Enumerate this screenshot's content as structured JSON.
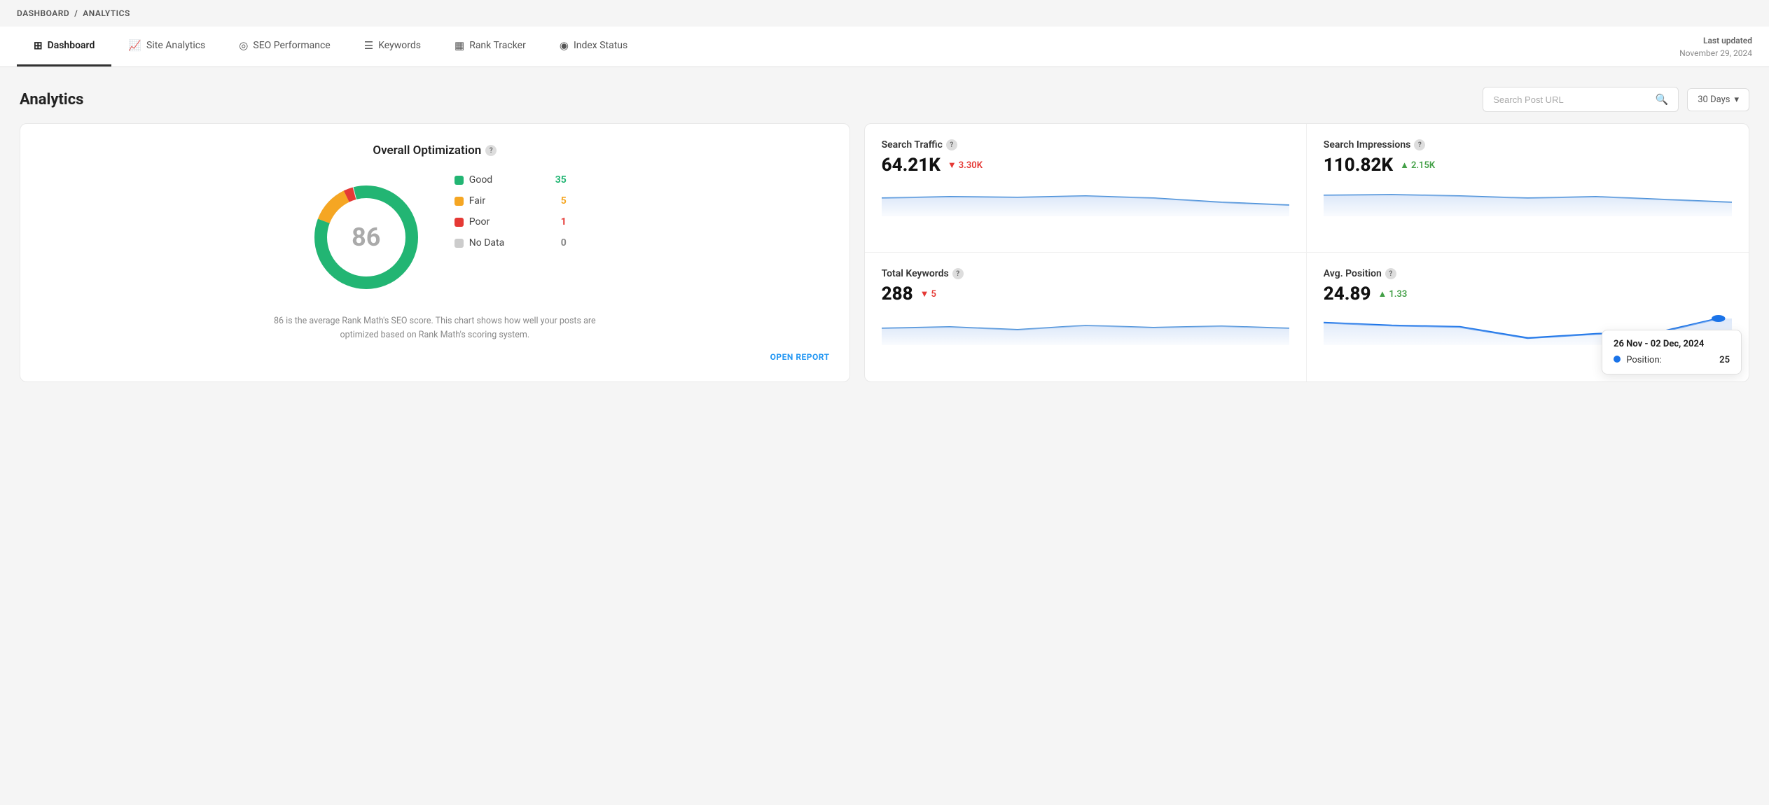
{
  "breadcrumb": {
    "parent": "DASHBOARD",
    "separator": "/",
    "current": "ANALYTICS"
  },
  "tabs": [
    {
      "id": "dashboard",
      "label": "Dashboard",
      "icon": "⊞",
      "active": true
    },
    {
      "id": "site-analytics",
      "label": "Site Analytics",
      "icon": "📈"
    },
    {
      "id": "seo-performance",
      "label": "SEO Performance",
      "icon": "◎"
    },
    {
      "id": "keywords",
      "label": "Keywords",
      "icon": "☰"
    },
    {
      "id": "rank-tracker",
      "label": "Rank Tracker",
      "icon": "▦"
    },
    {
      "id": "index-status",
      "label": "Index Status",
      "icon": "◉"
    }
  ],
  "last_updated": {
    "label": "Last updated",
    "date": "November 29, 2024"
  },
  "page_title": "Analytics",
  "search_placeholder": "Search Post URL",
  "days_filter": "30 Days",
  "optimization": {
    "title": "Overall Optimization",
    "score": "86",
    "legend": [
      {
        "label": "Good",
        "color": "#22b573",
        "count": "35",
        "count_color": "#22b573"
      },
      {
        "label": "Fair",
        "color": "#f5a623",
        "count": "5",
        "count_color": "#f5a623"
      },
      {
        "label": "Poor",
        "color": "#e53935",
        "count": "1",
        "count_color": "#e53935"
      },
      {
        "label": "No Data",
        "color": "#ccc",
        "count": "0",
        "count_color": "#888"
      }
    ],
    "description": "86 is the average Rank Math's SEO score. This chart shows how well your posts are optimized based on Rank Math's scoring system.",
    "open_report": "OPEN REPORT",
    "donut": {
      "good_pct": 85,
      "fair_pct": 12,
      "poor_pct": 3
    }
  },
  "metrics": [
    {
      "id": "search-traffic",
      "label": "Search Traffic",
      "value": "64.21K",
      "change": "3.30K",
      "change_dir": "down",
      "sparkline_type": "flat-down"
    },
    {
      "id": "search-impressions",
      "label": "Search Impressions",
      "value": "110.82K",
      "change": "2.15K",
      "change_dir": "up",
      "sparkline_type": "slight-down"
    },
    {
      "id": "total-keywords",
      "label": "Total Keywords",
      "value": "288",
      "change": "5",
      "change_dir": "down",
      "sparkline_type": "flat-curve"
    },
    {
      "id": "avg-position",
      "label": "Avg. Position",
      "value": "24.89",
      "change": "1.33",
      "change_dir": "up",
      "sparkline_type": "v-shape",
      "has_tooltip": true
    }
  ],
  "tooltip": {
    "date": "26 Nov - 02 Dec, 2024",
    "label": "Position:",
    "value": "25"
  }
}
